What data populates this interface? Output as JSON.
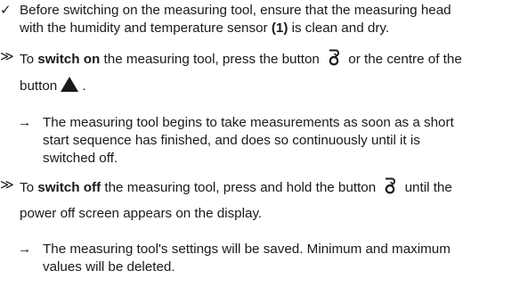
{
  "items": [
    {
      "marker": "✓",
      "line1": "Before switching on the measuring tool, ensure that the measuring head",
      "line2_pre": "with the humidity and temperature sensor ",
      "line2_bold": "(1)",
      "line2_post": " is clean and dry."
    },
    {
      "marker": "≫",
      "line1_pre": "To ",
      "line1_bold": "switch on",
      "line1_mid": " the measuring tool, press the button ",
      "line1_post": " or the centre of the",
      "line2_pre": "button ",
      "line2_post": "."
    },
    {
      "marker": "→",
      "line1": "The measuring tool begins to take measurements as soon as a short",
      "line2": "start sequence has finished, and does so continuously until it is",
      "line3": "switched off."
    },
    {
      "marker": "≫",
      "line1_pre": "To ",
      "line1_bold": "switch off",
      "line1_mid": " the measuring tool, press and hold the button ",
      "line1_post": " until the",
      "line2": "power off screen appears on the display."
    },
    {
      "marker": "→",
      "line1": "The measuring tool's settings will be saved. Minimum and maximum",
      "line2": "values will be deleted."
    }
  ],
  "icons": {
    "power": "power-button-icon",
    "triangle": "triangle-up-icon"
  }
}
